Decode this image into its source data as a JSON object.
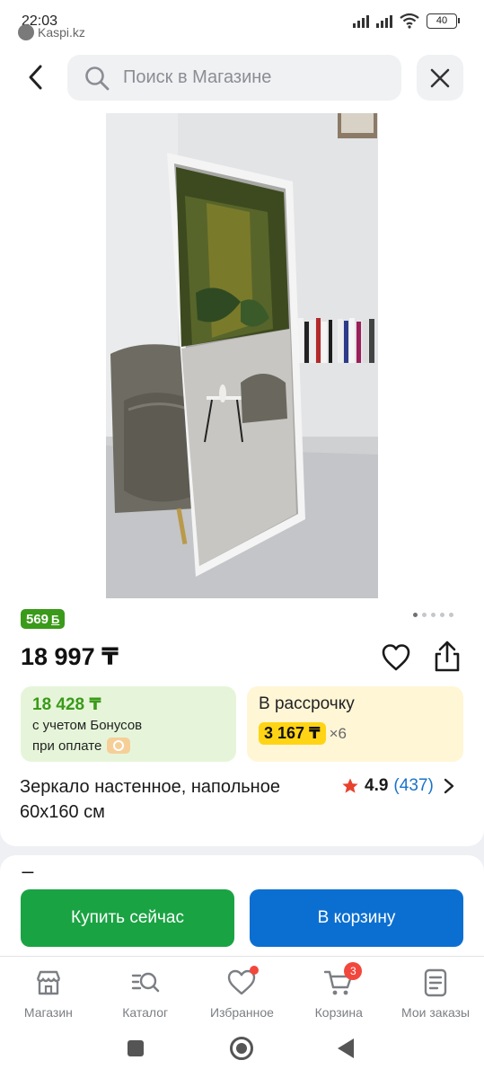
{
  "status_bar": {
    "time": "22:03",
    "source_app": "Kaspi.kz",
    "battery": "40"
  },
  "header": {
    "search_placeholder": "Поиск в Магазине"
  },
  "product": {
    "bonus_badge": "569",
    "bonus_unit": "Б",
    "price": "18 997 ₸",
    "bonus_price": {
      "amount": "18 428 ₸",
      "line1": "с учетом Бонусов",
      "line2": "при оплате"
    },
    "installment": {
      "title": "В рассрочку",
      "amount": "3 167 ₸",
      "multiplier": "×6"
    },
    "title": "Зеркало настенное, напольное 60х160 см",
    "rating": "4.9",
    "reviews": "(437)",
    "gallery": {
      "total": 5,
      "active": 1
    }
  },
  "sellers": {
    "heading": "Продавцы"
  },
  "actions": {
    "buy_now": "Купить сейчас",
    "add_to_cart": "В корзину"
  },
  "tabbar": [
    {
      "label": "Магазин",
      "icon": "shop-icon"
    },
    {
      "label": "Каталог",
      "icon": "catalog-search-icon"
    },
    {
      "label": "Избранное",
      "icon": "heart-icon"
    },
    {
      "label": "Корзина",
      "icon": "cart-icon",
      "badge": "3"
    },
    {
      "label": "Мои заказы",
      "icon": "orders-icon"
    }
  ],
  "colors": {
    "accent_green": "#1aa343",
    "accent_blue": "#0b6fd1",
    "bonus_green": "#3a9a1a",
    "installment_yellow": "#ffd414",
    "badge_red": "#f2473d",
    "star": "#e8412c"
  }
}
